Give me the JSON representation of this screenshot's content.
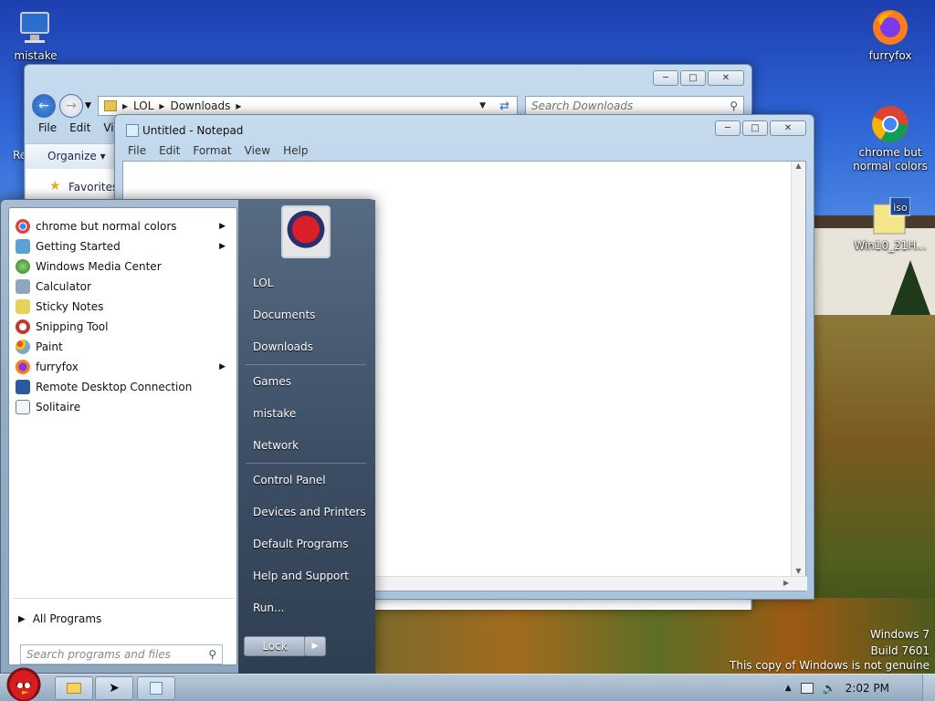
{
  "desktop": {
    "icons": [
      {
        "label": "mistake"
      },
      {
        "label": "furryfox"
      },
      {
        "label": "chrome but normal colors"
      },
      {
        "label": "Win10_21H..."
      }
    ],
    "partial_label": "Re",
    "watermark": {
      "line1": "Windows 7",
      "line2": "Build 7601",
      "line3": "This copy of Windows is not genuine"
    }
  },
  "explorer": {
    "breadcrumb": [
      "LOL",
      "Downloads"
    ],
    "search_placeholder": "Search Downloads",
    "menu": [
      "File",
      "Edit",
      "Vi"
    ],
    "organize_label": "Organize",
    "favorites_label": "Favorites"
  },
  "notepad": {
    "title": "Untitled - Notepad",
    "menu": [
      "File",
      "Edit",
      "Format",
      "View",
      "Help"
    ],
    "content": ""
  },
  "start_menu": {
    "programs": [
      {
        "label": "chrome but normal colors",
        "has_submenu": true,
        "color": "#4285f4"
      },
      {
        "label": "Getting Started",
        "has_submenu": true,
        "color": "#5aa1d8"
      },
      {
        "label": "Windows Media Center",
        "has_submenu": false,
        "color": "#3c8f2f"
      },
      {
        "label": "Calculator",
        "has_submenu": false,
        "color": "#8fa6bf"
      },
      {
        "label": "Sticky Notes",
        "has_submenu": false,
        "color": "#e8d35a"
      },
      {
        "label": "Snipping Tool",
        "has_submenu": false,
        "color": "#c0392b"
      },
      {
        "label": "Paint",
        "has_submenu": false,
        "color": "#7aa6cf"
      },
      {
        "label": "furryfox",
        "has_submenu": true,
        "color": "#e8651d"
      },
      {
        "label": "Remote Desktop Connection",
        "has_submenu": false,
        "color": "#2c5aa0"
      },
      {
        "label": "Solitaire",
        "has_submenu": false,
        "color": "#6d7f94"
      }
    ],
    "all_programs_label": "All Programs",
    "search_placeholder": "Search programs and files",
    "right_links": [
      "LOL",
      "Documents",
      "Downloads",
      "Games",
      "mistake",
      "Network",
      "Control Panel",
      "Devices and Printers",
      "Default Programs",
      "Help and Support",
      "Run..."
    ],
    "lock_label": "Lock"
  },
  "taskbar": {
    "clock": "2:02 PM"
  }
}
